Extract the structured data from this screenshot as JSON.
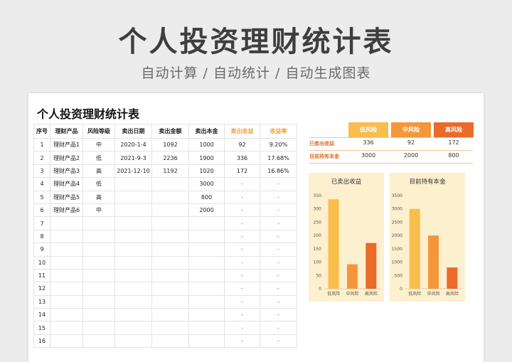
{
  "hero": {
    "title": "个人投资理财统计表",
    "subtitle": "自动计算 / 自动统计 / 自动生成图表"
  },
  "sheet": {
    "title": "个人投资理财统计表"
  },
  "table": {
    "headers": [
      "序号",
      "理财产品",
      "风险等级",
      "卖出日期",
      "卖出金额",
      "卖出本金",
      "卖出收益",
      "收益率"
    ],
    "rows": [
      [
        "1",
        "理财产品1",
        "中",
        "2020-1-4",
        "1092",
        "1000",
        "92",
        "9.20%"
      ],
      [
        "2",
        "理财产品2",
        "低",
        "2021-9-3",
        "2236",
        "1900",
        "336",
        "17.68%"
      ],
      [
        "3",
        "理财产品3",
        "高",
        "2021-12-10",
        "1192",
        "1020",
        "172",
        "16.86%"
      ],
      [
        "4",
        "理财产品4",
        "低",
        "",
        "",
        "3000",
        "-",
        "-"
      ],
      [
        "5",
        "理财产品5",
        "高",
        "",
        "",
        "800",
        "-",
        "-"
      ],
      [
        "6",
        "理财产品6",
        "中",
        "",
        "",
        "2000",
        "-",
        "-"
      ],
      [
        "7",
        "",
        "",
        "",
        "",
        "",
        "-",
        "-"
      ],
      [
        "8",
        "",
        "",
        "",
        "",
        "",
        "-",
        "-"
      ],
      [
        "9",
        "",
        "",
        "",
        "",
        "",
        "-",
        "-"
      ],
      [
        "10",
        "",
        "",
        "",
        "",
        "",
        "-",
        "-"
      ],
      [
        "11",
        "",
        "",
        "",
        "",
        "",
        "-",
        "-"
      ],
      [
        "12",
        "",
        "",
        "",
        "",
        "",
        "-",
        "-"
      ],
      [
        "13",
        "",
        "",
        "",
        "",
        "",
        "-",
        "-"
      ],
      [
        "14",
        "",
        "",
        "",
        "",
        "",
        "-",
        "-"
      ],
      [
        "15",
        "",
        "",
        "",
        "",
        "",
        "-",
        "-"
      ],
      [
        "16",
        "",
        "",
        "",
        "",
        "",
        "-",
        "-"
      ]
    ]
  },
  "summary": {
    "columns": [
      "低风险",
      "中风险",
      "高风险"
    ],
    "column_colors": [
      "#f9bd4c",
      "#f4973a",
      "#ea6a2a"
    ],
    "rows": [
      {
        "label": "已卖出收益",
        "values": [
          "336",
          "92",
          "172"
        ]
      },
      {
        "label": "目前持有本金",
        "values": [
          "3000",
          "2000",
          "800"
        ]
      }
    ]
  },
  "chart_data": [
    {
      "type": "bar",
      "title": "已卖出收益",
      "categories": [
        "低风险",
        "中风险",
        "高风险"
      ],
      "values": [
        336,
        92,
        172
      ],
      "ylim": [
        0,
        350
      ],
      "yticks": [
        0,
        50,
        100,
        150,
        200,
        250,
        300,
        350
      ],
      "colors": [
        "#f9bd4c",
        "#f4973a",
        "#ea6a2a"
      ]
    },
    {
      "type": "bar",
      "title": "目前持有本金",
      "categories": [
        "低风险",
        "中风险",
        "高风险"
      ],
      "values": [
        3000,
        2000,
        800
      ],
      "ylim": [
        0,
        3500
      ],
      "yticks": [
        0,
        500,
        1000,
        1500,
        2000,
        2500,
        3000,
        3500
      ],
      "colors": [
        "#f9bd4c",
        "#f4973a",
        "#ea6a2a"
      ]
    }
  ]
}
